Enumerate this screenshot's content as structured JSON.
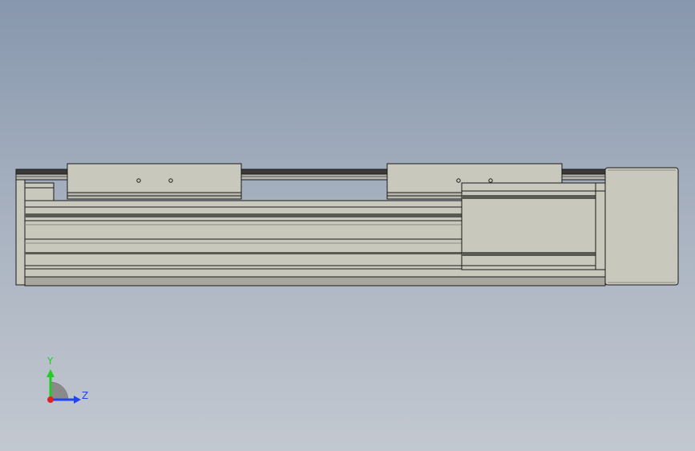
{
  "viewport": {
    "background_top": "#8797ad",
    "background_bottom": "#c3c8d0"
  },
  "model": {
    "body_color": "#c9c8bd",
    "edge_color": "#1a1a1a",
    "rail_color": "#3a3a3a",
    "shadow_color": "#8f8e86",
    "screw_count_per_carriage": 2
  },
  "triad": {
    "y_label": "Y",
    "z_label": "Z",
    "y_color": "#22cc22",
    "z_color": "#2244ee",
    "x_color": "#dd2222",
    "arc_color": "#8a8a8a"
  }
}
